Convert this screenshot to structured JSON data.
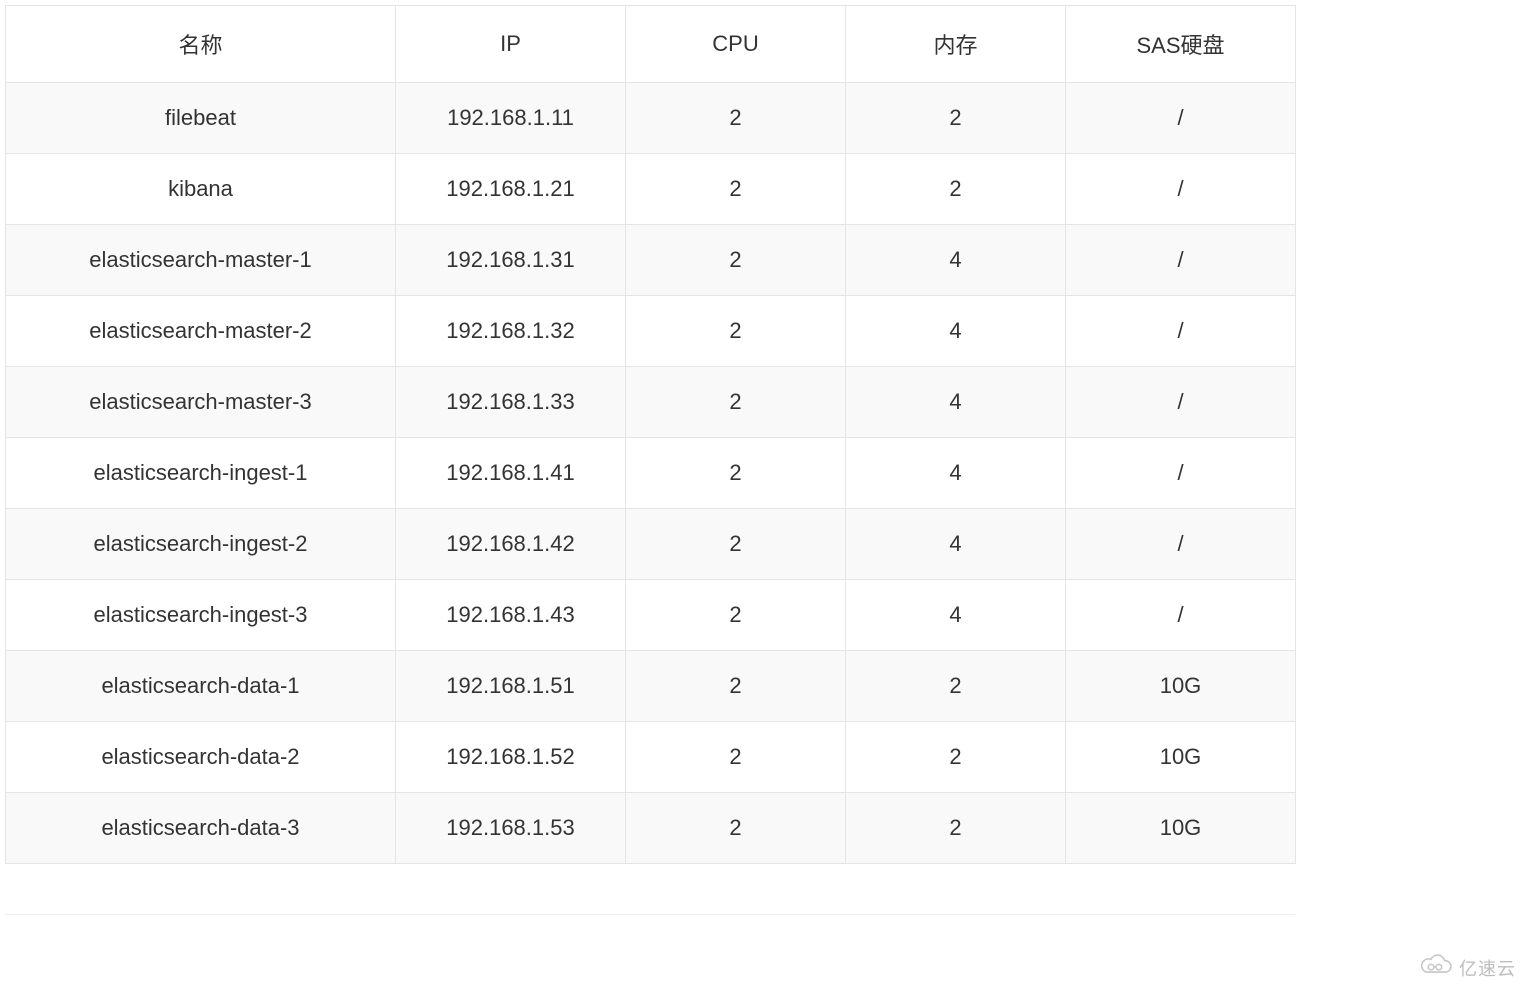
{
  "table": {
    "headers": [
      "名称",
      "IP",
      "CPU",
      "内存",
      "SAS硬盘"
    ],
    "rows": [
      {
        "name": "filebeat",
        "ip": "192.168.1.11",
        "cpu": "2",
        "mem": "2",
        "sas": "/"
      },
      {
        "name": "kibana",
        "ip": "192.168.1.21",
        "cpu": "2",
        "mem": "2",
        "sas": "/"
      },
      {
        "name": "elasticsearch-master-1",
        "ip": "192.168.1.31",
        "cpu": "2",
        "mem": "4",
        "sas": "/"
      },
      {
        "name": "elasticsearch-master-2",
        "ip": "192.168.1.32",
        "cpu": "2",
        "mem": "4",
        "sas": "/"
      },
      {
        "name": "elasticsearch-master-3",
        "ip": "192.168.1.33",
        "cpu": "2",
        "mem": "4",
        "sas": "/"
      },
      {
        "name": "elasticsearch-ingest-1",
        "ip": "192.168.1.41",
        "cpu": "2",
        "mem": "4",
        "sas": "/"
      },
      {
        "name": "elasticsearch-ingest-2",
        "ip": "192.168.1.42",
        "cpu": "2",
        "mem": "4",
        "sas": "/"
      },
      {
        "name": "elasticsearch-ingest-3",
        "ip": "192.168.1.43",
        "cpu": "2",
        "mem": "4",
        "sas": "/"
      },
      {
        "name": "elasticsearch-data-1",
        "ip": "192.168.1.51",
        "cpu": "2",
        "mem": "2",
        "sas": "10G"
      },
      {
        "name": "elasticsearch-data-2",
        "ip": "192.168.1.52",
        "cpu": "2",
        "mem": "2",
        "sas": "10G"
      },
      {
        "name": "elasticsearch-data-3",
        "ip": "192.168.1.53",
        "cpu": "2",
        "mem": "2",
        "sas": "10G"
      }
    ]
  },
  "watermark": {
    "text": "亿速云"
  }
}
